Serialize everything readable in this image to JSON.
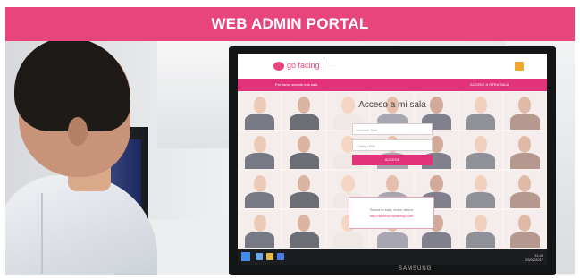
{
  "banner": {
    "title": "WEB ADMIN PORTAL",
    "color": "#e8457c"
  },
  "screen": {
    "brand_logo": {
      "icon": "pink-dot-logo",
      "text": "go facing",
      "subtext": "·· · ·"
    },
    "menu_icon": "hamburger-menu-icon",
    "subbar": {
      "left": "Por favor, accede a tu sala",
      "right": "ACCEDE A OTRA SALA"
    },
    "login": {
      "title": "Acceso a mi sala",
      "name_placeholder": "Nombre Sala",
      "pin_placeholder": "Código PIN",
      "access_button": "ACCEDE"
    },
    "help": {
      "line1": "Busca tu sala, entra, ahora",
      "line2": "http://access.myfacing.com"
    },
    "accent": "#e1327a",
    "taskbar": {
      "time": "11:48",
      "date": "23/02/2017"
    }
  },
  "monitor": {
    "brand": "SAMSUNG"
  }
}
